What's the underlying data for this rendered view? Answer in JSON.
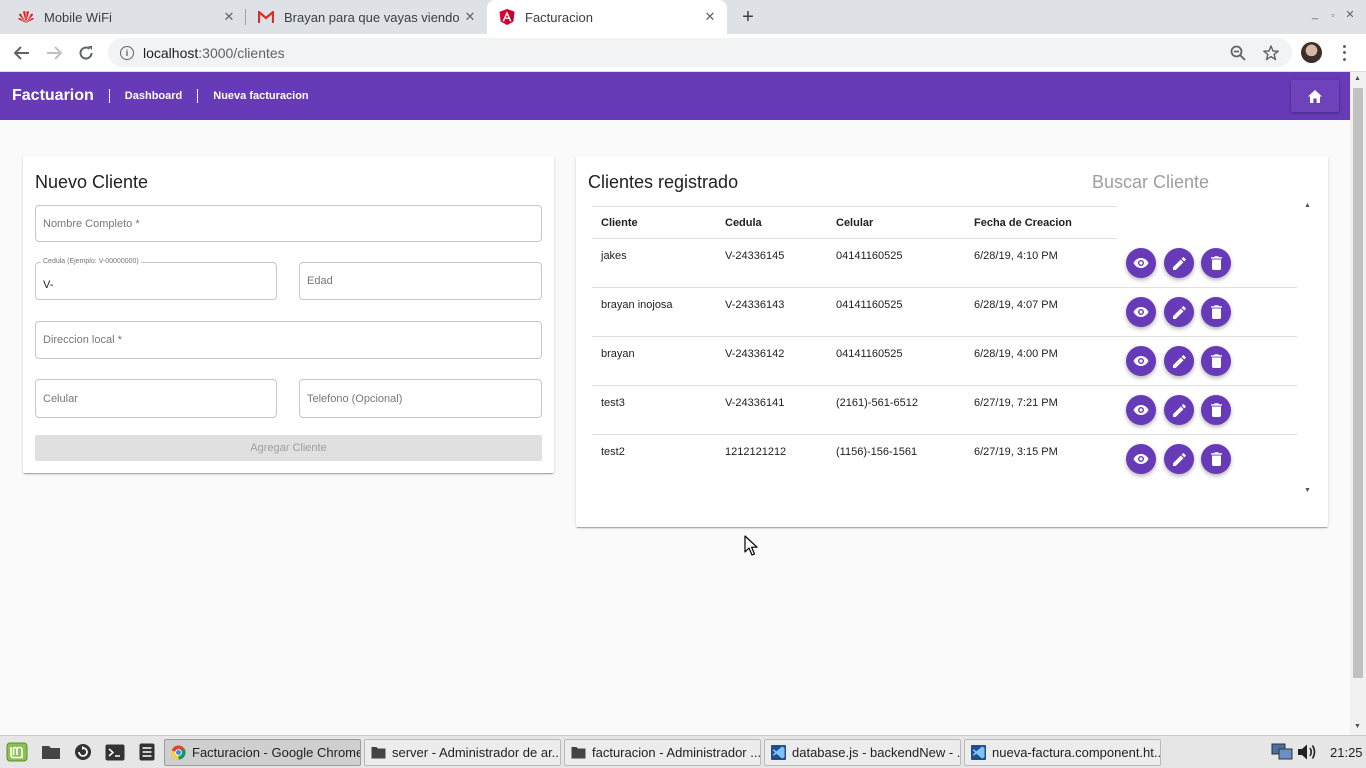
{
  "browser": {
    "tabs": [
      {
        "title": "Mobile WiFi",
        "favicon": "huawei-icon",
        "active": false
      },
      {
        "title": "Brayan para que vayas viendo",
        "favicon": "gmail-icon",
        "active": false
      },
      {
        "title": "Facturacion",
        "favicon": "angular-icon",
        "active": true
      }
    ],
    "url_host": "localhost",
    "url_path": ":3000/clientes"
  },
  "app": {
    "brand": "Factuarion",
    "nav": [
      "Dashboard",
      "Nueva facturacion"
    ],
    "primary_color": "#673ab7"
  },
  "form": {
    "title": "Nuevo Cliente",
    "nombre_placeholder": "Nombre Completo *",
    "cedula_label": "Cedula (Ejemplo: V-00000000)",
    "cedula_value": "V-",
    "edad_placeholder": "Edad",
    "direccion_placeholder": "Direccion local *",
    "celular_placeholder": "Celular",
    "telefono_placeholder": "Telefono (Opcional)",
    "submit_label": "Agregar Cliente"
  },
  "clients": {
    "title": "Clientes registrado",
    "search_placeholder": "Buscar Cliente",
    "columns": [
      "Cliente",
      "Cedula",
      "Celular",
      "Fecha de Creacion"
    ],
    "rows": [
      {
        "cliente": "jakes",
        "cedula": "V-24336145",
        "celular": "04141160525",
        "fecha": "6/28/19, 4:10 PM"
      },
      {
        "cliente": "brayan inojosa",
        "cedula": "V-24336143",
        "celular": "04141160525",
        "fecha": "6/28/19, 4:07 PM"
      },
      {
        "cliente": "brayan",
        "cedula": "V-24336142",
        "celular": "04141160525",
        "fecha": "6/28/19, 4:00 PM"
      },
      {
        "cliente": "test3",
        "cedula": "V-24336141",
        "celular": "(2161)-561-6512",
        "fecha": "6/27/19, 7:21 PM"
      },
      {
        "cliente": "test2",
        "cedula": "1212121212",
        "celular": "(1156)-156-1561",
        "fecha": "6/27/19, 3:15 PM"
      }
    ],
    "row_actions": [
      "eye-icon",
      "pencil-icon",
      "trash-icon"
    ]
  },
  "taskbar": {
    "tasks": [
      {
        "label": "Facturacion - Google Chrome",
        "icon": "chrome-icon",
        "active": true
      },
      {
        "label": "server - Administrador de ar...",
        "icon": "folder-icon",
        "active": false
      },
      {
        "label": "facturacion - Administrador ...",
        "icon": "folder-icon",
        "active": false
      },
      {
        "label": "database.js - backendNew - ...",
        "icon": "vscode-icon",
        "active": false
      },
      {
        "label": "nueva-factura.component.ht...",
        "icon": "vscode-icon",
        "active": false
      }
    ],
    "clock": "21:25"
  }
}
